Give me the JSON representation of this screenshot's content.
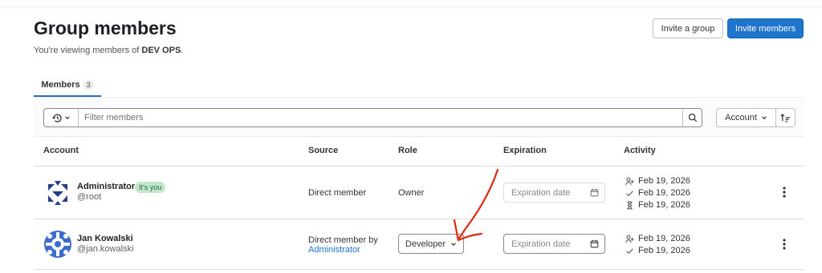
{
  "header": {
    "title": "Group members",
    "subtitle_prefix": "You're viewing members of ",
    "group_name": "DEV OPS",
    "subtitle_suffix": ".",
    "invite_group_label": "Invite a group",
    "invite_members_label": "Invite members"
  },
  "tabs": [
    {
      "label": "Members",
      "count": "3"
    }
  ],
  "filter": {
    "placeholder": "Filter members",
    "sort_label": "Account"
  },
  "table": {
    "columns": [
      "Account",
      "Source",
      "Role",
      "Expiration",
      "Activity"
    ],
    "rows": [
      {
        "name": "Administrator",
        "badge": "It's you",
        "username": "@root",
        "source": "Direct member",
        "source_link": "",
        "role": "Owner",
        "expiration_placeholder": "Expiration date",
        "activity": [
          "Feb 19, 2026",
          "Feb 19, 2026",
          "Feb 19, 2026"
        ]
      },
      {
        "name": "Jan Kowalski",
        "badge": "",
        "username": "@jan.kowalski",
        "source": "Direct member by",
        "source_link": "Administrator",
        "role": "Developer",
        "expiration_placeholder": "Expiration date",
        "activity": [
          "Feb 19, 2026",
          "Feb 19, 2026"
        ]
      }
    ]
  },
  "colors": {
    "primary": "#1f75cb",
    "annotation": "#dd2b0e",
    "badge_bg": "#c3e6cd"
  },
  "icons": {
    "history": "history-icon",
    "search": "search-icon",
    "sort_direction": "sort-lowest-icon",
    "user_plus": "user-plus-icon",
    "check": "check-icon",
    "hourglass": "hourglass-icon",
    "calendar": "calendar-icon",
    "kebab": "ellipsis-v-icon"
  }
}
